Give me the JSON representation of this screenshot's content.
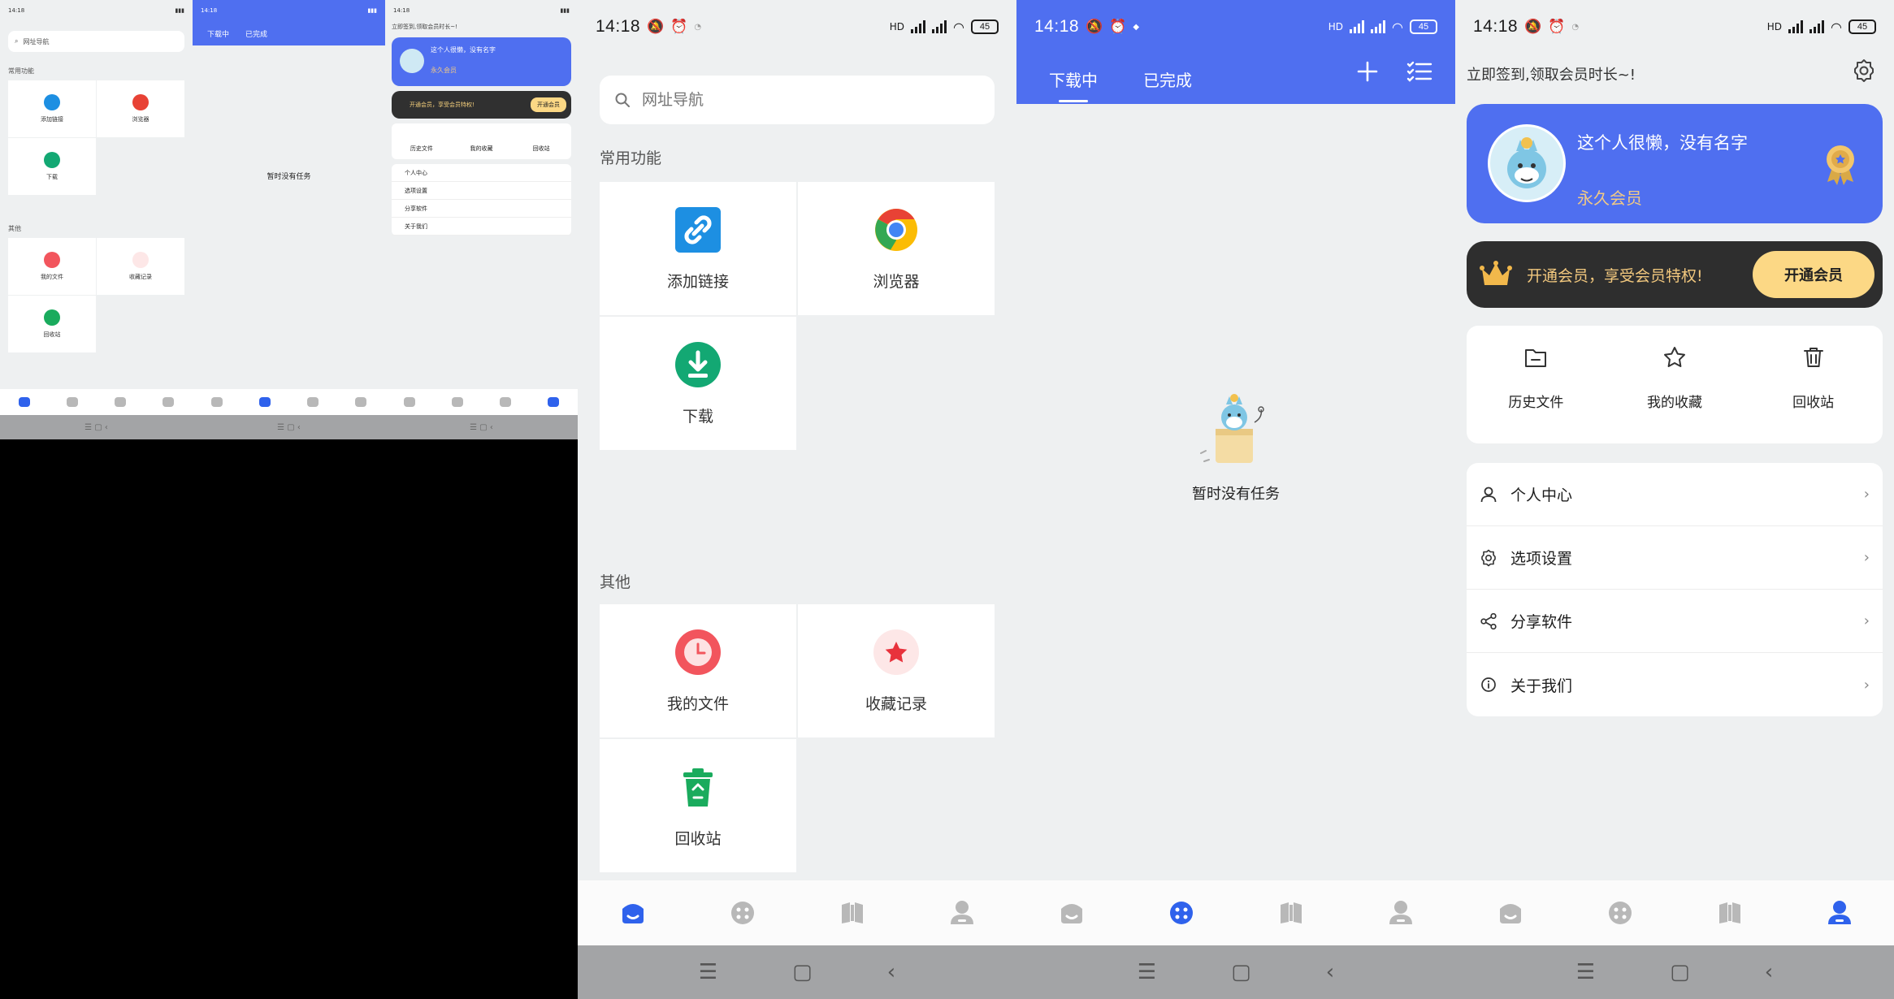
{
  "status": {
    "time": "14:18",
    "battery": "45",
    "network": "HD"
  },
  "thumbs": {
    "search_placeholder": "网址导航",
    "sec_common": "常用功能",
    "sec_other": "其他",
    "cells1": [
      "添加链接",
      "浏览器",
      "下载"
    ],
    "cells2": [
      "我的文件",
      "收藏记录",
      "回收站"
    ],
    "tab_downloading": "下载中",
    "tab_done": "已完成",
    "empty": "暂时没有任务",
    "sign_tip": "立即签到,领取会员时长~!",
    "name": "这个人很懒，没有名字",
    "level": "永久会员",
    "vip_text": "开通会员，享受会员特权!",
    "vip_btn": "开通会员",
    "quick": [
      "历史文件",
      "我的收藏",
      "回收站"
    ],
    "menu": [
      "个人中心",
      "选项设置",
      "分享软件",
      "关于我们"
    ]
  },
  "home": {
    "search_placeholder": "网址导航",
    "section_common": "常用功能",
    "section_other": "其他",
    "common": [
      {
        "label": "添加链接",
        "icon": "link-icon",
        "color": "#1d8fe2"
      },
      {
        "label": "浏览器",
        "icon": "chrome-icon",
        "color": "#e84235"
      },
      {
        "label": "下载",
        "icon": "download-icon",
        "color": "#13a873"
      }
    ],
    "other": [
      {
        "label": "我的文件",
        "icon": "clock-icon",
        "color": "#f2555d"
      },
      {
        "label": "收藏记录",
        "icon": "star-icon",
        "color": "#e8323c"
      },
      {
        "label": "回收站",
        "icon": "recycle-icon",
        "color": "#1aab5d"
      }
    ]
  },
  "tasks": {
    "tab_downloading": "下载中",
    "tab_done": "已完成",
    "empty_text": "暂时没有任务"
  },
  "mine": {
    "sign_tip": "立即签到,领取会员时长~!",
    "name": "这个人很懒，没有名字",
    "level": "永久会员",
    "vip_text": "开通会员，享受会员特权!",
    "vip_button": "开通会员",
    "quick": [
      "历史文件",
      "我的收藏",
      "回收站"
    ],
    "menu": [
      "个人中心",
      "选项设置",
      "分享软件",
      "关于我们"
    ]
  },
  "colors": {
    "primary": "#4f6ff0",
    "nav_active": "#2f62ec",
    "nav_inactive": "#b8b8b8",
    "vip_gold": "#fcd885"
  }
}
